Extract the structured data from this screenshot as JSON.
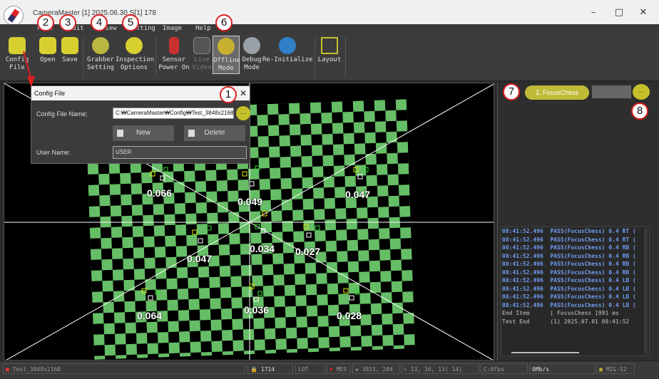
{
  "window": {
    "title": "CameraMaster [1] 2025.06.30 S[1] 178",
    "minimize": "–",
    "maximize": "□",
    "close": "✕"
  },
  "menu": [
    "File",
    "Edit",
    "View",
    "Setting",
    "Image",
    "Help"
  ],
  "toolbar": {
    "config": "Config\nFile",
    "open": "Open",
    "save": "Save",
    "grabber": "Grabber\nSetting",
    "inspection": "Inspection\nOptions",
    "sensor": "Sensor\nPower On",
    "live": "Live\nVideo",
    "offline": "Offline\nMode",
    "debug": "Debug\nMode",
    "reinit": "Re-Initialize",
    "layout": "Layout"
  },
  "config_dialog": {
    "title": "Config File",
    "file_label": "Config File Name:",
    "file_value": "C:₩CameraMaster₩Config₩Test_3848x2168",
    "browse": "...",
    "new_button": "New",
    "delete_button": "Delete",
    "user_label": "User Name:",
    "user_value": "USER"
  },
  "image_values": [
    "0.066",
    "0.049",
    "0.047",
    "0.047",
    "0.034",
    "0.027",
    "0.064",
    "0.036",
    "0.028"
  ],
  "right_panel": {
    "item_name": "2. FocusChess",
    "browse": "..."
  },
  "log": [
    {
      "text": "08:41:52.496  PASS(FocusChess) 0.4 RT (",
      "color": "#6f9cf0"
    },
    {
      "text": "08:41:52.496  PASS(FocusChess) 0.4 RT (",
      "color": "#6f9cf0"
    },
    {
      "text": "08:41:52.496  PASS(FocusChess) 0.4 RB (",
      "color": "#6f9cf0"
    },
    {
      "text": "08:41:52.496  PASS(FocusChess) 0.4 RB (",
      "color": "#6f9cf0"
    },
    {
      "text": "08:41:52.496  PASS(FocusChess) 0.4 RB (",
      "color": "#6f9cf0"
    },
    {
      "text": "08:41:52.496  PASS(FocusChess) 0.4 RB (",
      "color": "#6f9cf0"
    },
    {
      "text": "08:41:52.496  PASS(FocusChess) 0.4 LB (",
      "color": "#6f9cf0"
    },
    {
      "text": "08:41:52.496  PASS(FocusChess) 0.4 LB (",
      "color": "#6f9cf0"
    },
    {
      "text": "08:41:52.496  PASS(FocusChess) 0.4 LB (",
      "color": "#6f9cf0"
    },
    {
      "text": "08:41:52.496  PASS(FocusChess) 0.4 LB (",
      "color": "#6f9cf0"
    },
    {
      "text": "End Item      [ FocusChess ]991 ms",
      "color": "#9a9a9a"
    },
    {
      "text": "Test End      (1) 2025.07.01 08:41:52",
      "color": "#9a9a9a"
    }
  ],
  "annotations": [
    "1",
    "2",
    "3",
    "4",
    "5",
    "6",
    "7",
    "8"
  ],
  "status": {
    "file": "Test_3848x2168",
    "lock": "1714",
    "lot": "LOT",
    "mes": "MES",
    "coord": "3815, 204",
    "pixel": "13, 16, 13( 14)",
    "fps": "C:0fps",
    "rate": "0Mb/s",
    "device": "MIG-S2"
  },
  "colors": {
    "accent_yellow": "#c6c12a",
    "callout_red": "#e02020",
    "log_blue": "#6f9cf0",
    "roi_yellow": "#e6e600",
    "roi_green": "#30e030"
  },
  "icons": [
    "compass-logo-icon",
    "folder-icon",
    "floppy-icon",
    "grabber-icon",
    "inspection-icon",
    "sensor-icon",
    "video-icon",
    "offline-icon",
    "debug-icon",
    "reinit-icon",
    "layout-icon",
    "lock-icon",
    "mes-x-icon",
    "crosshair-icon",
    "eyedropper-icon"
  ]
}
